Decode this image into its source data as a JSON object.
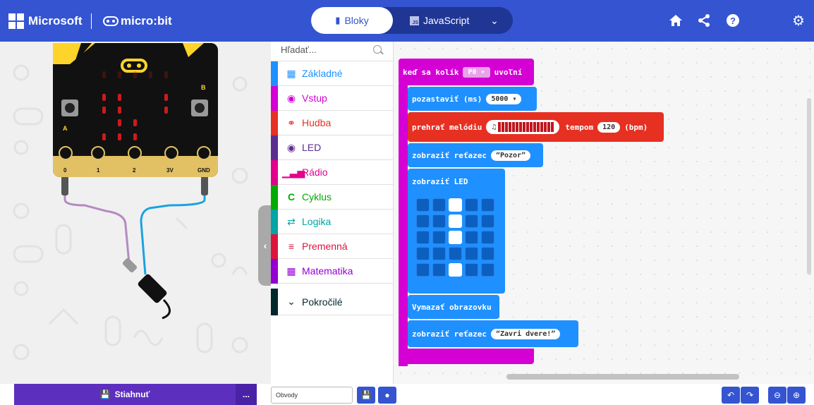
{
  "header": {
    "brand": "Microsoft",
    "product": "micro:bit",
    "tabs": {
      "blocks": "Bloky",
      "javascript": "JavaScript"
    },
    "js_badge": "JS",
    "buttons": {
      "home": "⌂",
      "share": "<",
      "help": "?",
      "settings": "⚙"
    }
  },
  "simulator": {
    "pin_labels": [
      "0",
      "1",
      "2",
      "3V",
      "GND"
    ],
    "button_labels": {
      "a": "A",
      "b": "B"
    }
  },
  "toolbox": {
    "search_placeholder": "Hľadať...",
    "categories": [
      {
        "label": "Základné",
        "color": "#1e90ff",
        "icon": "grid-icon"
      },
      {
        "label": "Vstup",
        "color": "#d400d4",
        "icon": "target-icon"
      },
      {
        "label": "Hudba",
        "color": "#e63022",
        "icon": "headphones-icon"
      },
      {
        "label": "LED",
        "color": "#5c2d91",
        "icon": "toggle-icon"
      },
      {
        "label": "Rádio",
        "color": "#e3008c",
        "icon": "signal-icon"
      },
      {
        "label": "Cyklus",
        "color": "#00aa00",
        "icon": "refresh-icon"
      },
      {
        "label": "Logika",
        "color": "#00a4a6",
        "icon": "shuffle-icon"
      },
      {
        "label": "Premenná",
        "color": "#dc143c",
        "icon": "list-icon"
      },
      {
        "label": "Matematika",
        "color": "#9400d3",
        "icon": "calculator-icon"
      },
      {
        "label": "Pokročilé",
        "color": "#00272b",
        "icon": "chevron-down-icon"
      }
    ]
  },
  "workspace": {
    "event": {
      "prefix": "keď sa kolík",
      "pin": "P0",
      "suffix": "uvoľní"
    },
    "pause": {
      "label": "pozastaviť (ms)",
      "value": "5000"
    },
    "melody": {
      "label": "prehrať melódiu",
      "tempo_label": "tempom",
      "tempo": "120",
      "unit": "(bpm)"
    },
    "show_string_1": {
      "label": "zobraziť reťazec",
      "value": "Pozor"
    },
    "show_leds": {
      "label": "zobraziť LED",
      "grid": [
        [
          0,
          0,
          1,
          0,
          0
        ],
        [
          0,
          0,
          1,
          0,
          0
        ],
        [
          0,
          0,
          1,
          0,
          0
        ],
        [
          0,
          0,
          0,
          0,
          0
        ],
        [
          0,
          0,
          1,
          0,
          0
        ]
      ]
    },
    "clear": {
      "label": "Vymazať obrazovku"
    },
    "show_string_2": {
      "label": "zobraziť reťazec",
      "value": "Zavri dvere!"
    }
  },
  "footer": {
    "download": "Stiahnuť",
    "more": "...",
    "project_name": "Obvody"
  }
}
